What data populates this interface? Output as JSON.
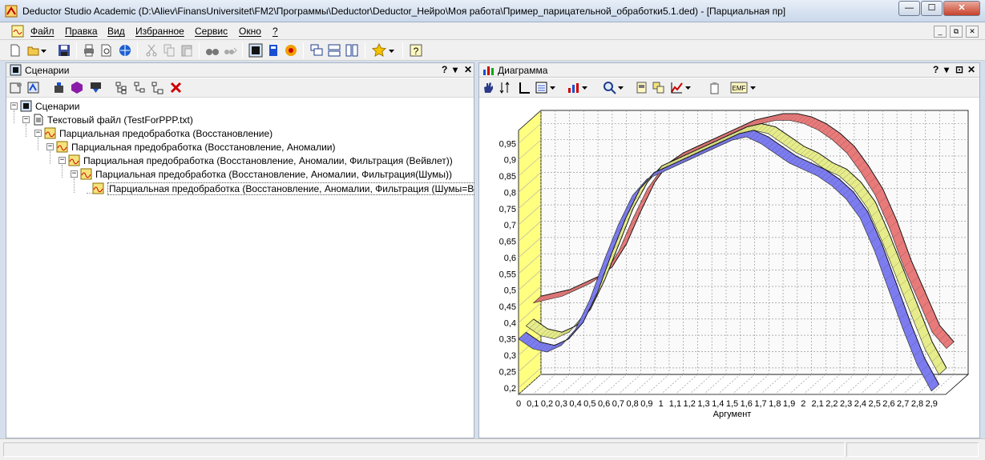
{
  "window": {
    "title": "Deductor Studio Academic (D:\\Aliev\\FinansUniversitet\\FM2\\Программы\\Deductor\\Deductor_Нейро\\Моя работа\\Пример_парицательной_обработки5.1.ded) - [Парциальная пр]",
    "minimize": "—",
    "maximize": "☐",
    "close": "✕"
  },
  "menu": {
    "items": [
      "Файл",
      "Правка",
      "Вид",
      "Избранное",
      "Сервис",
      "Окно",
      "?"
    ],
    "mdi_min": "_",
    "mdi_restore": "⧉",
    "mdi_close": "✕"
  },
  "scenarios_panel": {
    "title": "Сценарии",
    "help": "?",
    "pin": "▾",
    "close": "✕",
    "tree": [
      {
        "label": "Сценарии",
        "expander": "−"
      },
      {
        "label": "Текстовый файл (TestForPPP.txt)",
        "expander": "−"
      },
      {
        "label": "Парциальная предобработка (Восстановление)",
        "expander": "−"
      },
      {
        "label": "Парциальная предобработка (Восстановление, Аномалии)",
        "expander": "−"
      },
      {
        "label": "Парциальная предобработка (Восстановление, Аномалии, Фильтрация (Вейвлет))",
        "expander": "−"
      },
      {
        "label": "Парциальная предобработка (Восстановление, Аномалии, Фильтрация(Шумы))",
        "expander": "−"
      },
      {
        "label": "Парциальная предобработка (Восстановление, Аномалии, Фильтрация (Шумы=Вейвлет))",
        "expander": ""
      }
    ]
  },
  "chart_panel": {
    "title": "Диаграмма",
    "help": "?",
    "pin": "▾",
    "float": "⊡",
    "close": "✕",
    "emf_label": "EMF"
  },
  "colors": {
    "series_red": "#e87a7a",
    "series_yellow": "#e6ec8a",
    "series_blue": "#7c7cf0",
    "wall": "#ffff80",
    "accent": "#cc0000"
  },
  "chart_data": {
    "type": "area",
    "style": "3d-ribbon",
    "xlabel": "Аргумент",
    "x_ticks": [
      "0",
      "0,1",
      "0,2",
      "0,3",
      "0,4",
      "0,5",
      "0,6",
      "0,7",
      "0,8",
      "0,9",
      "1",
      "1,1",
      "1,2",
      "1,3",
      "1,4",
      "1,5",
      "1,6",
      "1,7",
      "1,8",
      "1,9",
      "2",
      "2,1",
      "2,2",
      "2,3",
      "2,4",
      "2,5",
      "2,6",
      "2,7",
      "2,8",
      "2,9"
    ],
    "y_ticks": [
      "0,2",
      "0,25",
      "0,3",
      "0,35",
      "0,4",
      "0,45",
      "0,5",
      "0,55",
      "0,6",
      "0,65",
      "0,7",
      "0,75",
      "0,8",
      "0,85",
      "0,9",
      "0,95"
    ],
    "ylim": [
      0.18,
      0.99
    ],
    "grid": true,
    "x": [
      0,
      0.1,
      0.2,
      0.3,
      0.4,
      0.5,
      0.6,
      0.7,
      0.8,
      0.9,
      1,
      1.1,
      1.2,
      1.3,
      1.4,
      1.5,
      1.6,
      1.7,
      1.8,
      1.9,
      2,
      2.1,
      2.2,
      2.3,
      2.4,
      2.5,
      2.6,
      2.7,
      2.8,
      2.9
    ],
    "series": [
      {
        "color_key": "series_red",
        "values": [
          0.42,
          0.43,
          0.44,
          0.46,
          0.48,
          0.51,
          0.58,
          0.68,
          0.77,
          0.83,
          0.86,
          0.88,
          0.9,
          0.92,
          0.94,
          0.96,
          0.97,
          0.98,
          0.98,
          0.97,
          0.95,
          0.92,
          0.88,
          0.82,
          0.75,
          0.65,
          0.53,
          0.43,
          0.33,
          0.28
        ]
      },
      {
        "color_key": "series_yellow",
        "values": [
          0.37,
          0.34,
          0.33,
          0.35,
          0.4,
          0.49,
          0.6,
          0.71,
          0.79,
          0.84,
          0.86,
          0.88,
          0.9,
          0.92,
          0.94,
          0.96,
          0.97,
          0.96,
          0.93,
          0.9,
          0.88,
          0.85,
          0.83,
          0.79,
          0.73,
          0.63,
          0.52,
          0.41,
          0.3,
          0.22
        ]
      },
      {
        "color_key": "series_blue",
        "values": [
          0.35,
          0.32,
          0.31,
          0.33,
          0.38,
          0.47,
          0.59,
          0.7,
          0.79,
          0.84,
          0.86,
          0.88,
          0.9,
          0.92,
          0.94,
          0.96,
          0.97,
          0.95,
          0.92,
          0.89,
          0.87,
          0.85,
          0.82,
          0.78,
          0.72,
          0.62,
          0.5,
          0.38,
          0.27,
          0.19
        ]
      }
    ]
  }
}
